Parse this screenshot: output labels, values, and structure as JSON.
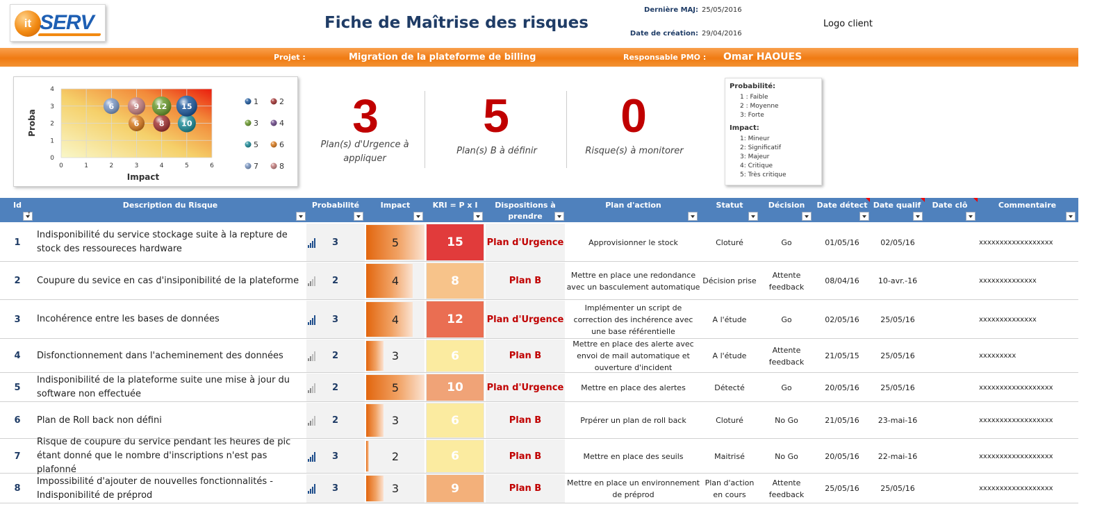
{
  "header": {
    "logo_it": "it",
    "logo_serv": "SERV",
    "title": "Fiche de Maîtrise des risques",
    "last_update_label": "Dernière  MAJ:",
    "last_update": "25/05/2016",
    "created_label": "Date de création:",
    "created": "29/04/2016",
    "logo_client": "Logo client"
  },
  "project_bar": {
    "project_label": "Projet :",
    "project_name": "Migration de la plateforme de billing",
    "pmo_label": "Responsable PMO :",
    "pmo_name": "Omar HAOUES"
  },
  "chart_data": {
    "type": "scatter",
    "xlabel": "Impact",
    "ylabel": "Proba",
    "xlim": [
      0,
      6
    ],
    "ylim": [
      0,
      4
    ],
    "x_ticks": [
      "0",
      "1",
      "2",
      "3",
      "4",
      "5",
      "6"
    ],
    "y_ticks": [
      "0",
      "1",
      "2",
      "3",
      "4"
    ],
    "points": [
      {
        "id": 1,
        "x": 5,
        "y": 3,
        "label": "15",
        "color": "#1f5a9e"
      },
      {
        "id": 2,
        "x": 4,
        "y": 2,
        "label": "8",
        "color": "#a23434"
      },
      {
        "id": 3,
        "x": 4,
        "y": 3,
        "label": "12",
        "color": "#6b9a2e"
      },
      {
        "id": 4,
        "x": 3,
        "y": 2,
        "label": "6",
        "color": "#6e4a8a"
      },
      {
        "id": 5,
        "x": 5,
        "y": 2,
        "label": "10",
        "color": "#1e8c99"
      },
      {
        "id": 6,
        "x": 3,
        "y": 2,
        "label": "6",
        "color": "#d87a1d"
      },
      {
        "id": 7,
        "x": 2,
        "y": 3,
        "label": "6",
        "color": "#7c98c4"
      },
      {
        "id": 8,
        "x": 3,
        "y": 3,
        "label": "9",
        "color": "#c47f7f"
      }
    ],
    "legend": [
      "1",
      "2",
      "3",
      "4",
      "5",
      "6",
      "7",
      "8"
    ],
    "legend_position": "right"
  },
  "kpis": [
    {
      "value": "3",
      "label_line1": "Plan(s) d'Urgence à",
      "label_line2": "appliquer"
    },
    {
      "value": "5",
      "label_line1": "Plan(s) B à définir",
      "label_line2": ""
    },
    {
      "value": "0",
      "label_line1": "Risque(s) à monitorer",
      "label_line2": ""
    }
  ],
  "legend_box": {
    "prob_title": "Probabilité:",
    "prob_items": [
      "1 : Faible",
      "2 : Moyenne",
      "3: Forte"
    ],
    "impact_title": "Impact:",
    "impact_items": [
      "1: Mineur",
      "2: Significatif",
      "3: Majeur",
      "4: Critique",
      "5: Très critique"
    ]
  },
  "table": {
    "headers": {
      "id": "Id",
      "desc": "Description du Risque",
      "prob": "Probabilité",
      "impact": "Impact",
      "kri": "KRI = P x I",
      "disp_1": "Dispositions à",
      "disp_2": "prendre",
      "plan": "Plan d'action",
      "statut": "Statut",
      "decision": "Décision",
      "detect": "Date détect",
      "qualif": "Date qualif",
      "clo": "Date clô",
      "comment": "Commentaire"
    },
    "rows": [
      {
        "id": "1",
        "desc": "Indisponibilité du service stockage suite à la repture de stock des ressoureces hardware",
        "prob": "3",
        "impact": "5",
        "impact_level": 1.0,
        "kri": "15",
        "kri_color": "#e13b3b",
        "disp": "Plan d'Urgence",
        "plan": "Approvisionner le stock",
        "statut": "Cloturé",
        "decision": "Go",
        "detect": "01/05/16",
        "qualif": "02/05/16",
        "clo": "",
        "comment": "xxxxxxxxxxxxxxxxxx"
      },
      {
        "id": "2",
        "desc": "Coupure du sevice en cas d'insiponibilité de la plateforme",
        "prob": "2",
        "impact": "4",
        "impact_level": 0.8,
        "kri": "8",
        "kri_color": "#f7c38a",
        "disp": "Plan B",
        "plan": "Mettre en place une redondance avec un basculement automatique",
        "statut": "Décision prise",
        "decision": "Attente feedback",
        "detect": "08/04/16",
        "qualif": "10-avr.-16",
        "clo": "",
        "comment": "xxxxxxxxxxxxxx"
      },
      {
        "id": "3",
        "desc": "Incohérence entre les bases de données",
        "prob": "3",
        "impact": "4",
        "impact_level": 0.8,
        "kri": "12",
        "kri_color": "#ea6e52",
        "disp": "Plan d'Urgence",
        "plan": "Implémenter un script de correction des inchérence avec une base référentielle",
        "statut": "A l'étude",
        "decision": "Go",
        "detect": "02/05/16",
        "qualif": "25/05/16",
        "clo": "",
        "comment": "xxxxxxxxxxxxxx"
      },
      {
        "id": "4",
        "desc": "Disfonctionnement dans l'acheminement des données",
        "prob": "2",
        "impact": "3",
        "impact_level": 0.3,
        "kri": "6",
        "kri_color": "#fbeba0",
        "disp": "Plan B",
        "plan": "Mettre en place des alerte avec envoi de mail automatique et ouverture d'incident",
        "statut": "A l'étude",
        "decision": "Attente feedback",
        "detect": "21/05/15",
        "qualif": "25/05/16",
        "clo": "",
        "comment": "xxxxxxxxx"
      },
      {
        "id": "5",
        "desc": "Indisponibilité de la plateforme suite une mise à jour du software non effectuée",
        "prob": "2",
        "impact": "5",
        "impact_level": 1.0,
        "kri": "10",
        "kri_color": "#f0a377",
        "disp": "Plan d'Urgence",
        "plan": "Mettre en place des alertes",
        "statut": "Détecté",
        "decision": "Go",
        "detect": "20/05/16",
        "qualif": "25/05/16",
        "clo": "",
        "comment": "xxxxxxxxxxxxxxxxxx"
      },
      {
        "id": "6",
        "desc": "Plan de Roll back non défini",
        "prob": "2",
        "impact": "3",
        "impact_level": 0.3,
        "kri": "6",
        "kri_color": "#fbeba0",
        "disp": "Plan B",
        "plan": "Prpérer un plan de roll back",
        "statut": "Cloturé",
        "decision": "No Go",
        "detect": "21/05/16",
        "qualif": "23-mai-16",
        "clo": "",
        "comment": "xxxxxxxxxxxxxxxxxx"
      },
      {
        "id": "7",
        "desc": "Risque de coupure du service pendant les heures de pic étant donné que le nombre d'inscriptions n'est pas plafonné",
        "prob": "3",
        "impact": "2",
        "impact_level": 0.0,
        "kri": "6",
        "kri_color": "#fbeba0",
        "disp": "Plan B",
        "plan": "Mettre en place des seuils",
        "statut": "Maitrisé",
        "decision": "No Go",
        "detect": "20/05/16",
        "qualif": "22-mai-16",
        "clo": "",
        "comment": "xxxxxxxxxxxxxxxxxx"
      },
      {
        "id": "8",
        "desc": "Impossibilité d'ajouter de nouvelles fonctionnalités - Indisponibilité de préprod",
        "prob": "3",
        "impact": "3",
        "impact_level": 0.3,
        "kri": "9",
        "kri_color": "#f3b07a",
        "disp": "Plan B",
        "plan": "Mettre en place un environnement de préprod",
        "statut": "Plan d'action en cours",
        "decision": "Attente feedback",
        "detect": "25/05/16",
        "qualif": "25/05/16",
        "clo": "",
        "comment": "xxxxxxxxxxxxxxxxxx"
      }
    ]
  }
}
